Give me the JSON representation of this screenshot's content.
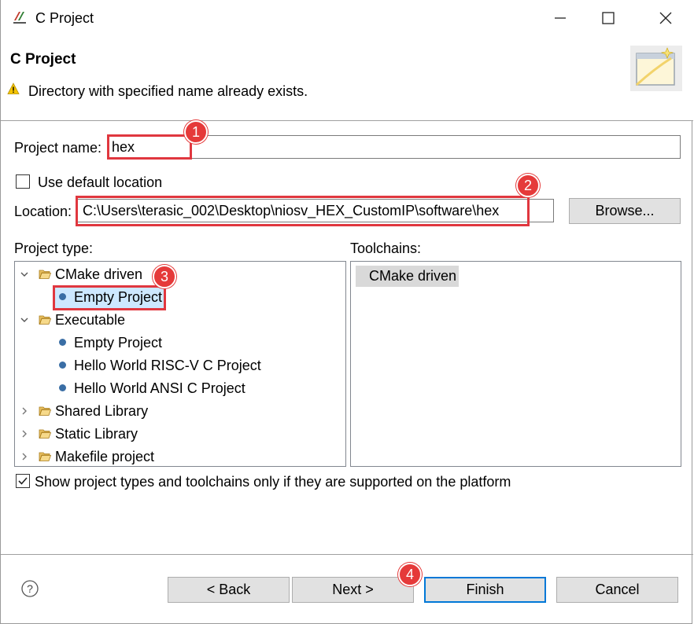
{
  "window": {
    "title": "C Project",
    "controls": [
      "minimize-icon",
      "maximize-icon",
      "close-icon"
    ]
  },
  "header": {
    "title": "C Project",
    "message": "Directory with specified name already exists.",
    "message_icon": "warning-icon"
  },
  "form": {
    "project_name_label": "Project name:",
    "project_name_value": "hex",
    "use_default_location_label": "Use default location",
    "use_default_location_checked": false,
    "location_label": "Location:",
    "location_value": "C:\\Users\\terasic_002\\Desktop\\niosv_HEX_CustomIP\\software\\hex",
    "browse_label": "Browse..."
  },
  "project_type": {
    "label": "Project type:",
    "items": [
      {
        "label": "CMake driven",
        "kind": "folder",
        "expanded": true
      },
      {
        "label": "Empty Project",
        "kind": "leaf",
        "selected": true
      },
      {
        "label": "Executable",
        "kind": "folder",
        "expanded": true
      },
      {
        "label": "Empty Project",
        "kind": "leaf"
      },
      {
        "label": "Hello World RISC-V C Project",
        "kind": "leaf"
      },
      {
        "label": "Hello World ANSI C Project",
        "kind": "leaf"
      },
      {
        "label": "Shared Library",
        "kind": "folder",
        "expanded": false
      },
      {
        "label": "Static Library",
        "kind": "folder",
        "expanded": false
      },
      {
        "label": "Makefile project",
        "kind": "folder",
        "expanded": false
      }
    ]
  },
  "toolchains": {
    "label": "Toolchains:",
    "items": [
      "CMake driven"
    ]
  },
  "filter_checkbox": {
    "label": "Show project types and toolchains only if they are supported on the platform",
    "checked": true
  },
  "buttons": {
    "back": "< Back",
    "next": "Next >",
    "finish": "Finish",
    "cancel": "Cancel"
  },
  "annotations": [
    "1",
    "2",
    "3",
    "4"
  ],
  "colors": {
    "annotation_red": "#e0373f",
    "selection": "#cde8ff",
    "default_button_border": "#0078d7"
  }
}
